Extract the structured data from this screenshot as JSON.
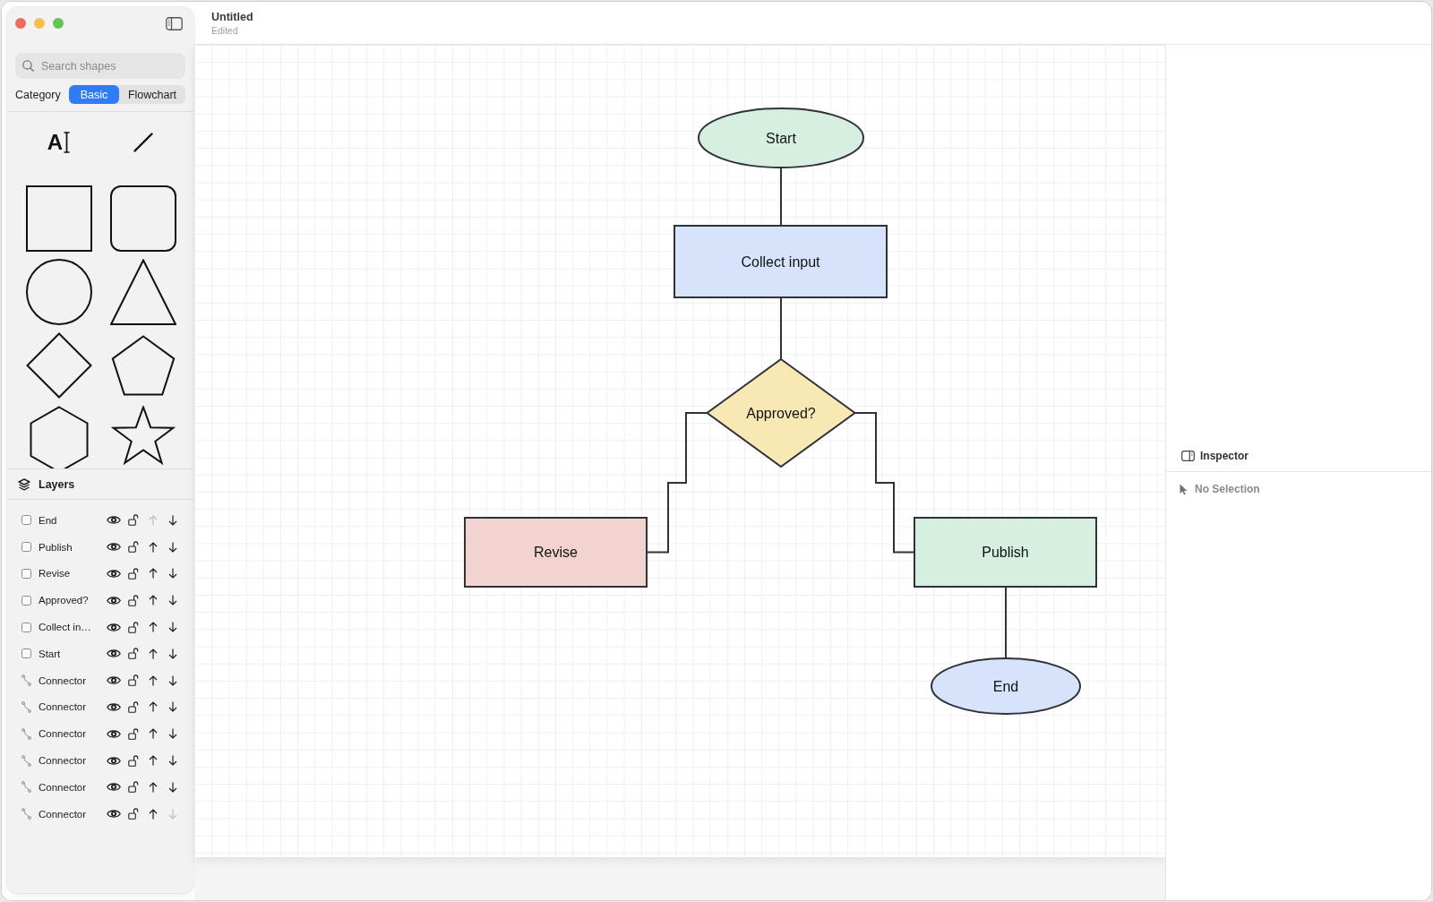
{
  "window": {
    "title": "Untitled",
    "status": "Edited"
  },
  "sidebar": {
    "search": {
      "placeholder": "Search shapes"
    },
    "category": {
      "label": "Category",
      "options": [
        {
          "label": "Basic",
          "selected": true
        },
        {
          "label": "Flowchart",
          "selected": false
        }
      ]
    },
    "shapes": [
      {
        "kind": "text",
        "glyph": "A"
      },
      {
        "kind": "line"
      },
      {
        "kind": "rectangle"
      },
      {
        "kind": "rounded-rectangle"
      },
      {
        "kind": "circle"
      },
      {
        "kind": "triangle"
      },
      {
        "kind": "diamond"
      },
      {
        "kind": "pentagon"
      },
      {
        "kind": "hexagon"
      },
      {
        "kind": "star"
      }
    ],
    "layers": {
      "title": "Layers",
      "items": [
        {
          "kind": "shape",
          "name": "End",
          "checked": false,
          "visible": true,
          "locked": false,
          "up_disabled": true,
          "down_disabled": false
        },
        {
          "kind": "shape",
          "name": "Publish",
          "checked": false,
          "visible": true,
          "locked": false,
          "up_disabled": false,
          "down_disabled": false
        },
        {
          "kind": "shape",
          "name": "Revise",
          "checked": false,
          "visible": true,
          "locked": false,
          "up_disabled": false,
          "down_disabled": false
        },
        {
          "kind": "shape",
          "name": "Approved?",
          "checked": false,
          "visible": true,
          "locked": false,
          "up_disabled": false,
          "down_disabled": false
        },
        {
          "kind": "shape",
          "name": "Collect in…",
          "checked": false,
          "visible": true,
          "locked": false,
          "up_disabled": false,
          "down_disabled": false
        },
        {
          "kind": "shape",
          "name": "Start",
          "checked": false,
          "visible": true,
          "locked": false,
          "up_disabled": false,
          "down_disabled": false
        },
        {
          "kind": "connector",
          "name": "Connector",
          "visible": true,
          "locked": false,
          "up_disabled": false,
          "down_disabled": false
        },
        {
          "kind": "connector",
          "name": "Connector",
          "visible": true,
          "locked": false,
          "up_disabled": false,
          "down_disabled": false
        },
        {
          "kind": "connector",
          "name": "Connector",
          "visible": true,
          "locked": false,
          "up_disabled": false,
          "down_disabled": false
        },
        {
          "kind": "connector",
          "name": "Connector",
          "visible": true,
          "locked": false,
          "up_disabled": false,
          "down_disabled": false
        },
        {
          "kind": "connector",
          "name": "Connector",
          "visible": true,
          "locked": false,
          "up_disabled": false,
          "down_disabled": false
        },
        {
          "kind": "connector",
          "name": "Connector",
          "visible": true,
          "locked": false,
          "up_disabled": false,
          "down_disabled": true
        }
      ]
    }
  },
  "canvas": {
    "nodes": [
      {
        "kind": "terminal",
        "label": "Start",
        "color": "#d6efe0"
      },
      {
        "kind": "process",
        "label": "Collect input",
        "color": "#d6e3fa"
      },
      {
        "kind": "decision",
        "label": "Approved?",
        "color": "#f8e8b4"
      },
      {
        "kind": "process",
        "label": "Revise",
        "color": "#f2d3cf"
      },
      {
        "kind": "process",
        "label": "Publish",
        "color": "#d6efe0"
      },
      {
        "kind": "terminal",
        "label": "End",
        "color": "#d6e3fa"
      }
    ]
  },
  "inspector": {
    "title": "Inspector",
    "selection": "No Selection"
  }
}
